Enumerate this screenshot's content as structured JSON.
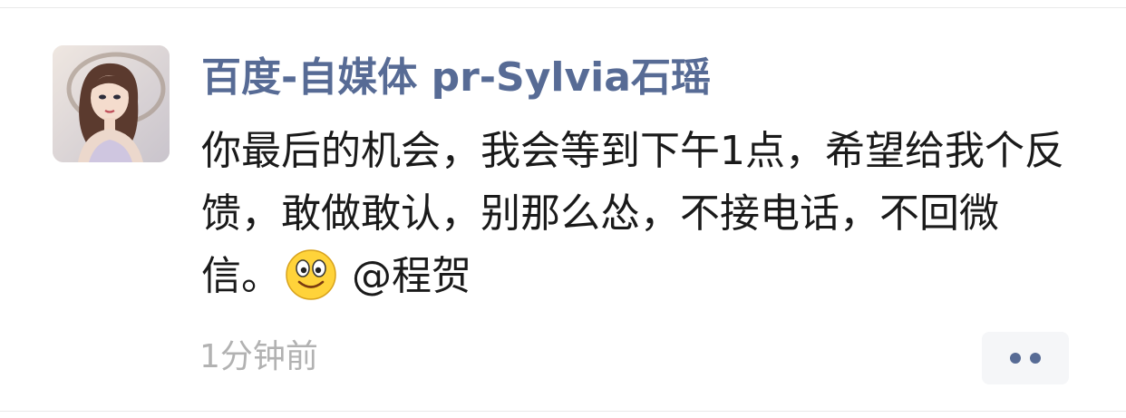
{
  "post": {
    "author_name": "百度-自媒体 pr-Sylvia石瑶",
    "text_before_emoji": "你最后的机会，我会等到下午1点，希望给我个反馈，敢做敢认，别那么怂，不接电话，不回微信。",
    "emoji": "smiley-face",
    "mention": "@程贺",
    "timestamp": "1分钟前",
    "more_icon": "two-dots-icon"
  },
  "colors": {
    "author_name": "#576b95",
    "body_text": "#1a1a1a",
    "timestamp": "#b2b2b2",
    "more_button_bg": "#f5f6f8"
  }
}
